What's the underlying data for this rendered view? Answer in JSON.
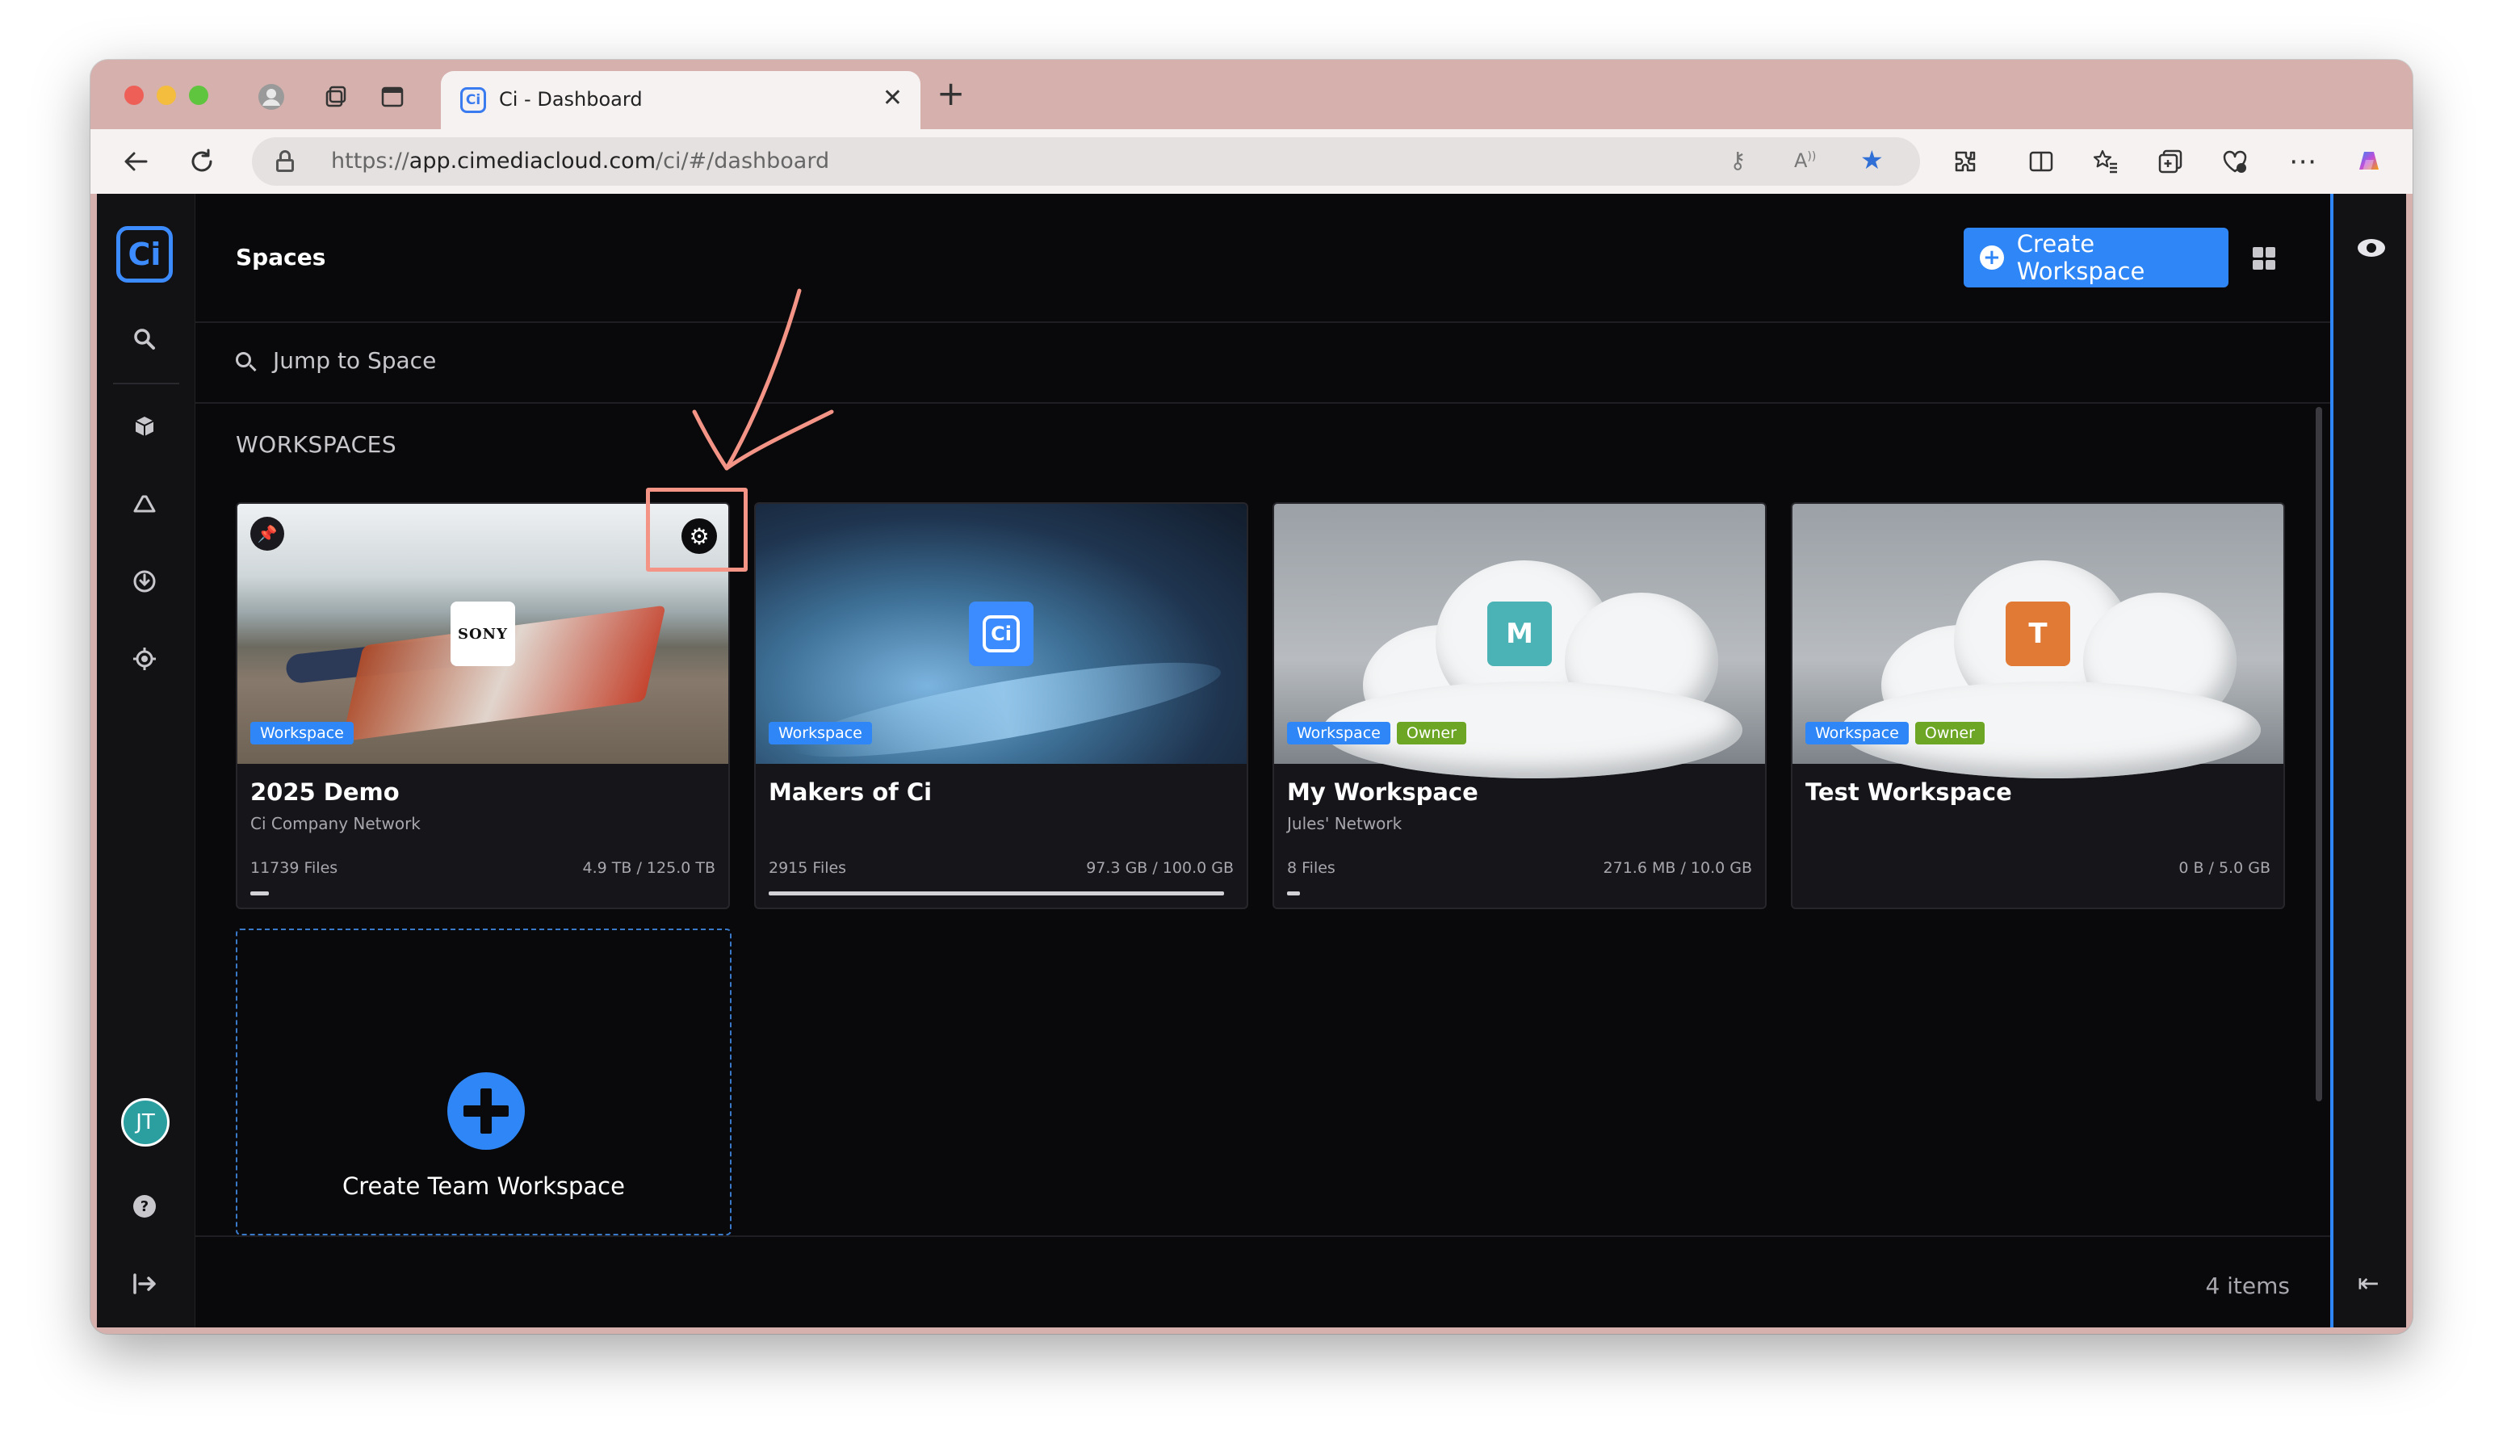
{
  "browser": {
    "tab_title": "Ci - Dashboard",
    "url_prefix": "https://",
    "url_host": "app.cimediacloud.com",
    "url_path": "/ci/#/dashboard",
    "favicon_letter": "Ci"
  },
  "app": {
    "logo_text": "Ci",
    "avatar_initials": "JT",
    "header_title": "Spaces",
    "create_button": "Create Workspace",
    "search_placeholder": "Jump to Space",
    "section_title": "WORKSPACES",
    "footer_count": "4 items",
    "accent_color": "#2f86f6"
  },
  "workspaces": [
    {
      "name": "2025 Demo",
      "network": "Ci Company Network",
      "files": "11739 Files",
      "storage": "4.9 TB / 125.0 TB",
      "usage_fraction": 0.039,
      "tags": [
        "Workspace"
      ],
      "badge": "SONY",
      "pinned": true
    },
    {
      "name": "Makers of Ci",
      "network": "",
      "files": "2915 Files",
      "storage": "97.3 GB / 100.0 GB",
      "usage_fraction": 0.973,
      "tags": [
        "Workspace"
      ],
      "badge": "Ci",
      "pinned": false
    },
    {
      "name": "My Workspace",
      "network": "Jules' Network",
      "files": "8 Files",
      "storage": "271.6 MB / 10.0 GB",
      "usage_fraction": 0.027,
      "tags": [
        "Workspace",
        "Owner"
      ],
      "badge": "M",
      "badge_color": "#4bb3b5",
      "pinned": false
    },
    {
      "name": "Test Workspace",
      "network": "",
      "files": "",
      "storage": "0 B / 5.0 GB",
      "usage_fraction": 0,
      "tags": [
        "Workspace",
        "Owner"
      ],
      "badge": "T",
      "badge_color": "#e07a35",
      "pinned": false
    }
  ],
  "add_card_label": "Create Team Workspace"
}
